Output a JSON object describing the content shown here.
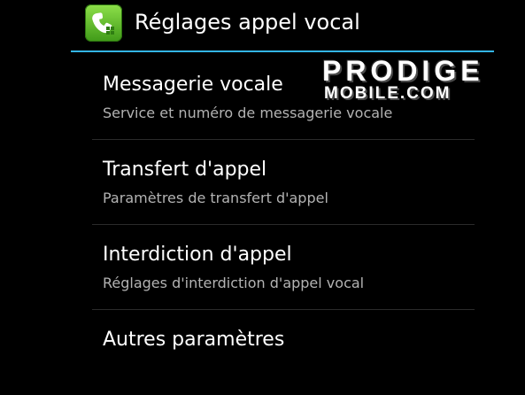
{
  "action_bar": {
    "title": "Réglages appel vocal",
    "icon": "phone-settings-icon",
    "accent_color": "#33b5e5"
  },
  "watermark": {
    "line1": "PRODIGE",
    "line2": "MOBILE.COM"
  },
  "settings": {
    "items": [
      {
        "title": "Messagerie vocale",
        "summary": "Service et numéro de messagerie vocale"
      },
      {
        "title": "Transfert d'appel",
        "summary": "Paramètres de transfert d'appel"
      },
      {
        "title": "Interdiction d'appel",
        "summary": "Réglages d'interdiction d'appel vocal"
      },
      {
        "title": "Autres paramètres"
      }
    ]
  }
}
